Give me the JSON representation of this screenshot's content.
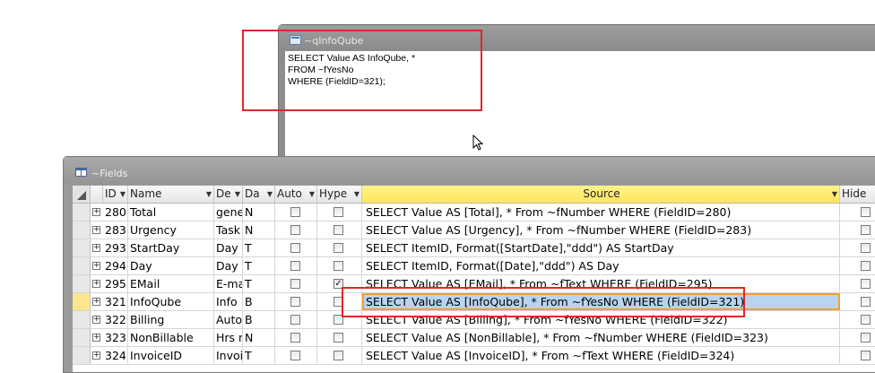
{
  "query_window": {
    "title": "~qInfoQube",
    "sql_lines": [
      "SELECT Value AS InfoQube, *",
      "FROM ~fYesNo",
      "WHERE (FieldID=321);"
    ]
  },
  "fields_window": {
    "title": "~Fields",
    "columns": [
      "ID",
      "Name",
      "De",
      "Da",
      "Auto",
      "Hype",
      "Source",
      "Hide"
    ],
    "rows": [
      {
        "id": "280",
        "name": "Total",
        "de": "gene",
        "da": "N",
        "auto": false,
        "hype": false,
        "source": "SELECT Value AS [Total], * From ~fNumber WHERE (FieldID=280)",
        "hide": false
      },
      {
        "id": "283",
        "name": "Urgency",
        "de": "Task",
        "da": "N",
        "auto": false,
        "hype": false,
        "source": "SELECT Value AS [Urgency], * From ~fNumber WHERE (FieldID=283)",
        "hide": false
      },
      {
        "id": "293",
        "name": "StartDay",
        "de": "Day o",
        "da": "T",
        "auto": false,
        "hype": false,
        "source": "SELECT ItemID, Format([StartDate],\"ddd\") AS StartDay",
        "hide": false
      },
      {
        "id": "294",
        "name": "Day",
        "de": "Day o",
        "da": "T",
        "auto": false,
        "hype": false,
        "source": "SELECT ItemID, Format([Date],\"ddd\") AS Day",
        "hide": false
      },
      {
        "id": "295",
        "name": "EMail",
        "de": "E-ma",
        "da": "T",
        "auto": false,
        "hype": true,
        "source": "SELECT Value AS [EMail], * From ~fText WHERE (FieldID=295)",
        "hide": false
      },
      {
        "id": "321",
        "name": "InfoQube",
        "de": "Info",
        "da": "B",
        "auto": false,
        "hype": false,
        "source": "SELECT Value AS [InfoQube], * From ~fYesNo WHERE (FieldID=321)",
        "hide": false
      },
      {
        "id": "322",
        "name": "Billing",
        "de": "Auto",
        "da": "B",
        "auto": false,
        "hype": false,
        "source": "SELECT Value AS [Billing], * From ~fYesNo WHERE (FieldID=322)",
        "hide": false
      },
      {
        "id": "323",
        "name": "NonBillable",
        "de": "Hrs n",
        "da": "N",
        "auto": false,
        "hype": false,
        "source": "SELECT Value AS [NonBillable], * From ~fNumber WHERE (FieldID=323)",
        "hide": false
      },
      {
        "id": "324",
        "name": "InvoiceID",
        "de": "Invoi",
        "da": "T",
        "auto": false,
        "hype": false,
        "source": "SELECT Value AS [InvoiceID], * From ~fText WHERE (FieldID=324)",
        "hide": false
      }
    ],
    "current_row_index": 5
  },
  "colors": {
    "highlight_border": "#e0262a",
    "selected_header": "#ffe55c",
    "selected_cell": "#b8d4f0"
  }
}
